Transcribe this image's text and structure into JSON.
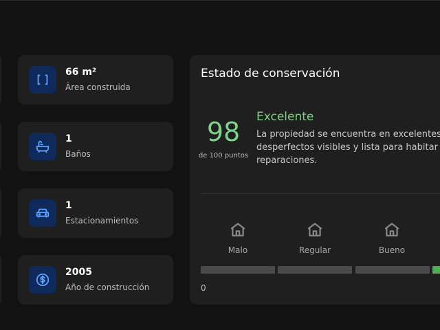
{
  "stats": [
    {
      "icon": "area-icon",
      "value": "66 m²",
      "label": "Àrea construida"
    },
    {
      "icon": "bathtub-icon",
      "value": "1",
      "label": "Baños"
    },
    {
      "icon": "car-icon",
      "value": "1",
      "label": "Estacionamientos"
    },
    {
      "icon": "dollar-icon",
      "value": "2005",
      "label": "Año de construcción"
    }
  ],
  "condition": {
    "title": "Estado de conservación",
    "score": "98",
    "score_caption": "de 100 puntos",
    "rating": "Excelente",
    "description": "La propiedad se encuentra en excelentes c desperfectos visibles y lista para habitar sir reparaciones.",
    "scale": [
      {
        "icon": "house-icon",
        "label": "Malo"
      },
      {
        "icon": "house-icon",
        "label": "Regular"
      },
      {
        "icon": "house-icon",
        "label": "Bueno"
      }
    ],
    "axis_start": "0",
    "colors": {
      "accent": "#7fd088",
      "active_bar": "#4caf50",
      "icon_bg": "#0f2a5a",
      "icon": "#5ea0ff"
    }
  }
}
